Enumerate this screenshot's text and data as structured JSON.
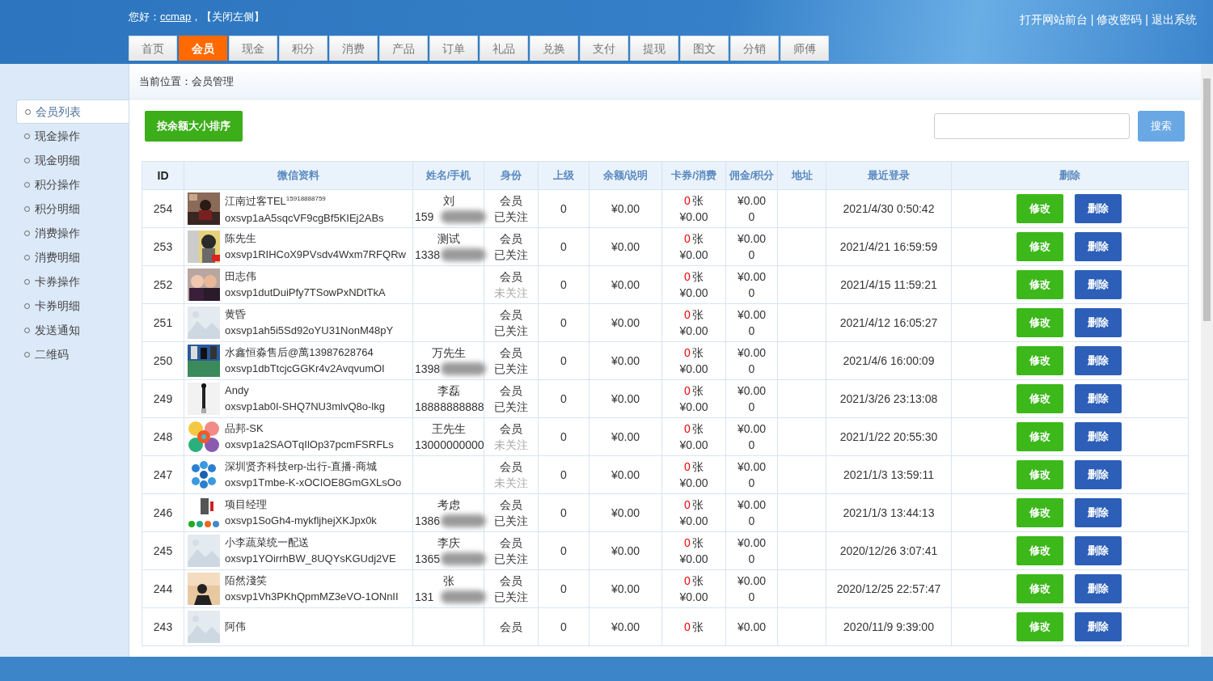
{
  "header": {
    "greeting": "您好：",
    "user": "ccmap",
    "greeting_sep": "，",
    "close_left": "【关闭左侧】",
    "links": [
      "打开网站前台",
      "修改密码",
      "退出系统"
    ],
    "link_sep": "|"
  },
  "nav_tabs": [
    {
      "label": "首页",
      "selected": false
    },
    {
      "label": "会员",
      "selected": true
    },
    {
      "label": "现金",
      "selected": false
    },
    {
      "label": "积分",
      "selected": false
    },
    {
      "label": "消费",
      "selected": false
    },
    {
      "label": "产品",
      "selected": false
    },
    {
      "label": "订单",
      "selected": false
    },
    {
      "label": "礼品",
      "selected": false
    },
    {
      "label": "兑换",
      "selected": false
    },
    {
      "label": "支付",
      "selected": false
    },
    {
      "label": "提现",
      "selected": false
    },
    {
      "label": "图文",
      "selected": false
    },
    {
      "label": "分销",
      "selected": false
    },
    {
      "label": "师傅",
      "selected": false
    }
  ],
  "breadcrumb": "当前位置：会员管理",
  "sidebar": {
    "items": [
      {
        "label": "会员列表",
        "selected": true
      },
      {
        "label": "现金操作",
        "selected": false
      },
      {
        "label": "现金明细",
        "selected": false
      },
      {
        "label": "积分操作",
        "selected": false
      },
      {
        "label": "积分明细",
        "selected": false
      },
      {
        "label": "消费操作",
        "selected": false
      },
      {
        "label": "消费明细",
        "selected": false
      },
      {
        "label": "卡券操作",
        "selected": false
      },
      {
        "label": "卡券明细",
        "selected": false
      },
      {
        "label": "发送通知",
        "selected": false
      },
      {
        "label": "二维码",
        "selected": false
      }
    ]
  },
  "toolbar": {
    "sort_button": "按余额大小排序",
    "search_button": "搜索"
  },
  "table": {
    "columns": [
      "ID",
      "微信资料",
      "姓名/手机",
      "身份",
      "上级",
      "余额/说明",
      "卡券/消费",
      "佣金/积分",
      "地址",
      "最近登录",
      "删除"
    ],
    "rows": [
      {
        "id": "254",
        "nickname": "江南过客TEL$^{15918888759}$",
        "openid": "oxsvp1aA5sqcVF9cgBf5KIEj2ABs",
        "name": "刘",
        "phone": "159",
        "phone_masked": true,
        "role": "会员",
        "follow": "已关注",
        "followed": true,
        "parent": "0",
        "balance": "¥0.00",
        "coupons": "0",
        "coupon_unit": "张",
        "spent": "¥0.00",
        "commission": "¥0.00",
        "points": "0",
        "last_login": "2021/4/30 0:50:42",
        "edit": "修改",
        "delete": "删除"
      },
      {
        "id": "253",
        "nickname": "陈先生",
        "openid": "oxsvp1RIHCoX9PVsdv4Wxm7RFQRw",
        "name": "测试",
        "phone": "1338",
        "phone_masked": true,
        "role": "会员",
        "follow": "已关注",
        "followed": true,
        "parent": "0",
        "balance": "¥0.00",
        "coupons": "0",
        "coupon_unit": "张",
        "spent": "¥0.00",
        "commission": "¥0.00",
        "points": "0",
        "last_login": "2021/4/21 16:59:59",
        "edit": "修改",
        "delete": "删除"
      },
      {
        "id": "252",
        "nickname": "田志伟",
        "openid": "oxsvp1dutDuiPfy7TSowPxNDtTkA",
        "role": "会员",
        "follow": "未关注",
        "followed": false,
        "parent": "0",
        "balance": "¥0.00",
        "coupons": "0",
        "coupon_unit": "张",
        "spent": "¥0.00",
        "commission": "¥0.00",
        "points": "0",
        "last_login": "2021/4/15 11:59:21",
        "edit": "修改",
        "delete": "删除"
      },
      {
        "id": "251",
        "nickname": "黄昏",
        "openid": "oxsvp1ah5i5Sd92oYU31NonM48pY",
        "role": "会员",
        "follow": "已关注",
        "followed": true,
        "parent": "0",
        "balance": "¥0.00",
        "coupons": "0",
        "coupon_unit": "张",
        "spent": "¥0.00",
        "commission": "¥0.00",
        "points": "0",
        "last_login": "2021/4/12 16:05:27",
        "edit": "修改",
        "delete": "删除"
      },
      {
        "id": "250",
        "nickname": "水鑫恒淼售后@萬13987628764",
        "openid": "oxsvp1dbTtcjcGGKr4v2AvqvumOI",
        "name": "万先生",
        "phone": "1398",
        "phone_masked": true,
        "role": "会员",
        "follow": "已关注",
        "followed": true,
        "parent": "0",
        "balance": "¥0.00",
        "coupons": "0",
        "coupon_unit": "张",
        "spent": "¥0.00",
        "commission": "¥0.00",
        "points": "0",
        "last_login": "2021/4/6 16:00:09",
        "edit": "修改",
        "delete": "删除"
      },
      {
        "id": "249",
        "nickname": "Andy",
        "openid": "oxsvp1ab0I-SHQ7NU3mlvQ8o-lkg",
        "name": "李磊",
        "phone": "18888888888",
        "phone_masked": false,
        "role": "会员",
        "follow": "已关注",
        "followed": true,
        "parent": "0",
        "balance": "¥0.00",
        "coupons": "0",
        "coupon_unit": "张",
        "spent": "¥0.00",
        "commission": "¥0.00",
        "points": "0",
        "last_login": "2021/3/26 23:13:08",
        "edit": "修改",
        "delete": "删除"
      },
      {
        "id": "248",
        "nickname": "品邦-SK",
        "openid": "oxsvp1a2SAOTqIlOp37pcmFSRFLs",
        "name": "王先生",
        "phone": "13000000000",
        "phone_masked": false,
        "role": "会员",
        "follow": "未关注",
        "followed": false,
        "parent": "0",
        "balance": "¥0.00",
        "coupons": "0",
        "coupon_unit": "张",
        "spent": "¥0.00",
        "commission": "¥0.00",
        "points": "0",
        "last_login": "2021/1/22 20:55:30",
        "edit": "修改",
        "delete": "删除"
      },
      {
        "id": "247",
        "nickname": "深圳贤齐科技erp-出行-直播-商城",
        "openid": "oxsvp1Tmbe-K-xOCIOE8GmGXLsOo",
        "role": "会员",
        "follow": "未关注",
        "followed": false,
        "parent": "0",
        "balance": "¥0.00",
        "coupons": "0",
        "coupon_unit": "张",
        "spent": "¥0.00",
        "commission": "¥0.00",
        "points": "0",
        "last_login": "2021/1/3 13:59:11",
        "edit": "修改",
        "delete": "删除"
      },
      {
        "id": "246",
        "nickname": "项目经理",
        "openid": "oxsvp1SoGh4-mykfljhejXKJpx0k",
        "name": "考虑",
        "phone": "1386",
        "phone_masked": true,
        "role": "会员",
        "follow": "已关注",
        "followed": true,
        "parent": "0",
        "balance": "¥0.00",
        "coupons": "0",
        "coupon_unit": "张",
        "spent": "¥0.00",
        "commission": "¥0.00",
        "points": "0",
        "last_login": "2021/1/3 13:44:13",
        "edit": "修改",
        "delete": "删除"
      },
      {
        "id": "245",
        "nickname": "小李蔬菜统一配送",
        "openid": "oxsvp1YOirrhBW_8UQYsKGUdj2VE",
        "name": "李庆",
        "phone": "1365",
        "phone_masked": true,
        "role": "会员",
        "follow": "已关注",
        "followed": true,
        "parent": "0",
        "balance": "¥0.00",
        "coupons": "0",
        "coupon_unit": "张",
        "spent": "¥0.00",
        "commission": "¥0.00",
        "points": "0",
        "last_login": "2020/12/26 3:07:41",
        "edit": "修改",
        "delete": "删除"
      },
      {
        "id": "244",
        "nickname": "陌然淺笑",
        "openid": "oxsvp1Vh3PKhQpmMZ3eVO-1ONnII",
        "name": "张",
        "phone": "131",
        "phone_masked": true,
        "role": "会员",
        "follow": "已关注",
        "followed": true,
        "parent": "0",
        "balance": "¥0.00",
        "coupons": "0",
        "coupon_unit": "张",
        "spent": "¥0.00",
        "commission": "¥0.00",
        "points": "0",
        "last_login": "2020/12/25 22:57:47",
        "edit": "修改",
        "delete": "删除"
      },
      {
        "id": "243",
        "nickname": "阿伟",
        "role": "会员",
        "parent": "0",
        "balance": "¥0.00",
        "coupons": "0",
        "coupon_unit": "张",
        "commission": "¥0.00",
        "last_login": "2020/11/9 9:39:00",
        "edit": "修改",
        "delete": "删除"
      }
    ]
  }
}
